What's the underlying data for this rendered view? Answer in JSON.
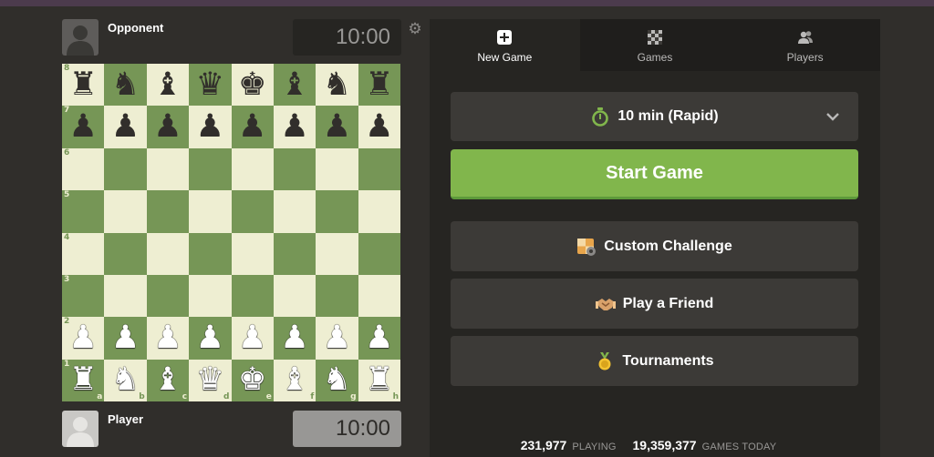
{
  "opponent": {
    "name": "Opponent",
    "clock": "10:00"
  },
  "player": {
    "name": "Player",
    "clock": "10:00"
  },
  "board": {
    "ranks": [
      "8",
      "7",
      "6",
      "5",
      "4",
      "3",
      "2",
      "1"
    ],
    "files": [
      "a",
      "b",
      "c",
      "d",
      "e",
      "f",
      "g",
      "h"
    ],
    "pieces": [
      [
        "♜",
        "♞",
        "♝",
        "♛",
        "♚",
        "♝",
        "♞",
        "♜"
      ],
      [
        "♟",
        "♟",
        "♟",
        "♟",
        "♟",
        "♟",
        "♟",
        "♟"
      ],
      [
        "",
        "",
        "",
        "",
        "",
        "",
        "",
        ""
      ],
      [
        "",
        "",
        "",
        "",
        "",
        "",
        "",
        ""
      ],
      [
        "",
        "",
        "",
        "",
        "",
        "",
        "",
        ""
      ],
      [
        "",
        "",
        "",
        "",
        "",
        "",
        "",
        ""
      ],
      [
        "♟",
        "♟",
        "♟",
        "♟",
        "♟",
        "♟",
        "♟",
        "♟"
      ],
      [
        "♜",
        "♞",
        "♝",
        "♛",
        "♚",
        "♝",
        "♞",
        "♜"
      ]
    ],
    "piece_colors": [
      "black",
      "black",
      "",
      "",
      "",
      "",
      "white",
      "white"
    ]
  },
  "tabs": [
    {
      "label": "New Game",
      "icon": "plus-square-icon",
      "active": true
    },
    {
      "label": "Games",
      "icon": "chessboard-icon",
      "active": false
    },
    {
      "label": "Players",
      "icon": "players-icon",
      "active": false
    }
  ],
  "time_control": {
    "label": "10 min (Rapid)",
    "icon": "stopwatch-icon"
  },
  "start_button": "Start Game",
  "custom_challenge": "Custom Challenge",
  "play_friend": "Play a Friend",
  "tournaments": "Tournaments",
  "stats": {
    "playing_count": "231,977",
    "playing_label": "PLAYING",
    "games_today_count": "19,359,377",
    "games_today_label": "GAMES TODAY"
  },
  "colors": {
    "accent_green": "#81b64c",
    "board_light": "#eeeed2",
    "board_dark": "#769656",
    "background": "#302e2b"
  }
}
